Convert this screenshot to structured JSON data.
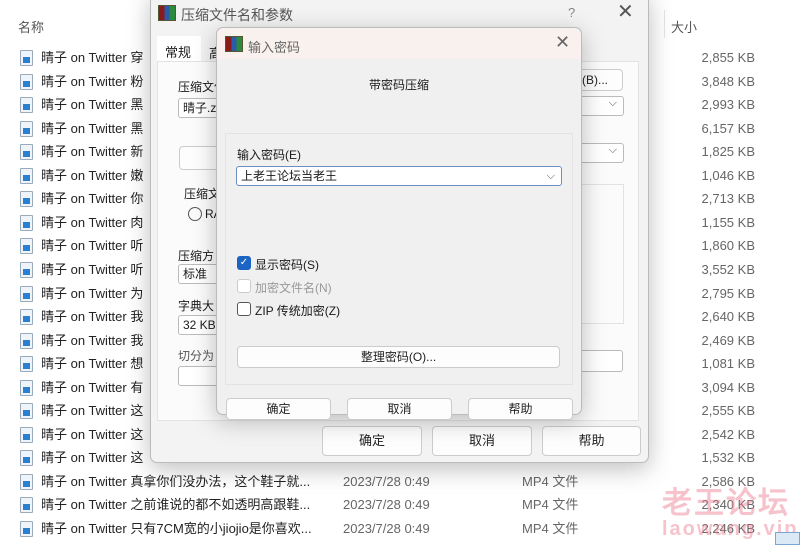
{
  "explorer": {
    "col_name": "名称",
    "col_size": "大小",
    "rows": [
      {
        "name": "晴子 on Twitter 穿",
        "size": "2,855 KB"
      },
      {
        "name": "晴子 on Twitter 粉",
        "size": "3,848 KB"
      },
      {
        "name": "晴子 on Twitter 黑",
        "size": "2,993 KB"
      },
      {
        "name": "晴子 on Twitter 黑",
        "size": "6,157 KB"
      },
      {
        "name": "晴子 on Twitter 新",
        "size": "1,825 KB"
      },
      {
        "name": "晴子 on Twitter 嫩",
        "size": "1,046 KB"
      },
      {
        "name": "晴子 on Twitter 你",
        "size": "2,713 KB"
      },
      {
        "name": "晴子 on Twitter 肉",
        "size": "1,155 KB"
      },
      {
        "name": "晴子 on Twitter 听",
        "size": "1,860 KB"
      },
      {
        "name": "晴子 on Twitter 听",
        "size": "3,552 KB"
      },
      {
        "name": "晴子 on Twitter 为",
        "size": "2,795 KB"
      },
      {
        "name": "晴子 on Twitter 我",
        "size": "2,640 KB"
      },
      {
        "name": "晴子 on Twitter 我",
        "size": "2,469 KB"
      },
      {
        "name": "晴子 on Twitter 想",
        "size": "1,081 KB"
      },
      {
        "name": "晴子 on Twitter 有",
        "size": "3,094 KB"
      },
      {
        "name": "晴子 on Twitter 这",
        "size": "2,555 KB"
      },
      {
        "name": "晴子 on Twitter 这",
        "size": "2,542 KB"
      },
      {
        "name": "晴子 on Twitter 这",
        "size": "1,532 KB"
      },
      {
        "name": "晴子 on Twitter 真拿你们没办法，这个鞋子就...",
        "date": "2023/7/28 0:49",
        "type": "MP4 文件",
        "size": "2,586 KB"
      },
      {
        "name": "晴子 on Twitter 之前谁说的都不如透明高跟鞋...",
        "date": "2023/7/28 0:49",
        "type": "MP4 文件",
        "size": "2,340 KB"
      },
      {
        "name": "晴子 on Twitter 只有7CM宽的小jiojio是你喜欢...",
        "date": "2023/7/28 0:49",
        "type": "MP4 文件",
        "size": "2,246 KB"
      }
    ]
  },
  "archive_dialog": {
    "title": "压缩文件名和参数",
    "help": "?",
    "tab_general": "常规",
    "tab_advanced": "高",
    "label_archive_name": "压缩文件",
    "archive_name": "晴子.zi",
    "browse": "(B)...",
    "group_format": "压缩文",
    "radio_rar": "RA",
    "label_method": "压缩方",
    "method": "标准",
    "label_dict": "字典大",
    "dict": "32 KB",
    "label_split": "切分为",
    "ok": "确定",
    "cancel": "取消",
    "help_btn": "帮助"
  },
  "password_dialog": {
    "title": "输入密码",
    "heading": "带密码压缩",
    "label_password": "输入密码(E)",
    "password": "上老王论坛当老王",
    "show_password": "显示密码(S)",
    "show_password_checked": true,
    "encrypt_names": "加密文件名(N)",
    "encrypt_names_enabled": false,
    "zip_legacy": "ZIP 传统加密(Z)",
    "zip_legacy_checked": false,
    "organize": "整理密码(O)...",
    "ok": "确定",
    "cancel": "取消",
    "help": "帮助"
  },
  "watermark": {
    "text": "老王论坛",
    "url": "laowang.vip"
  }
}
